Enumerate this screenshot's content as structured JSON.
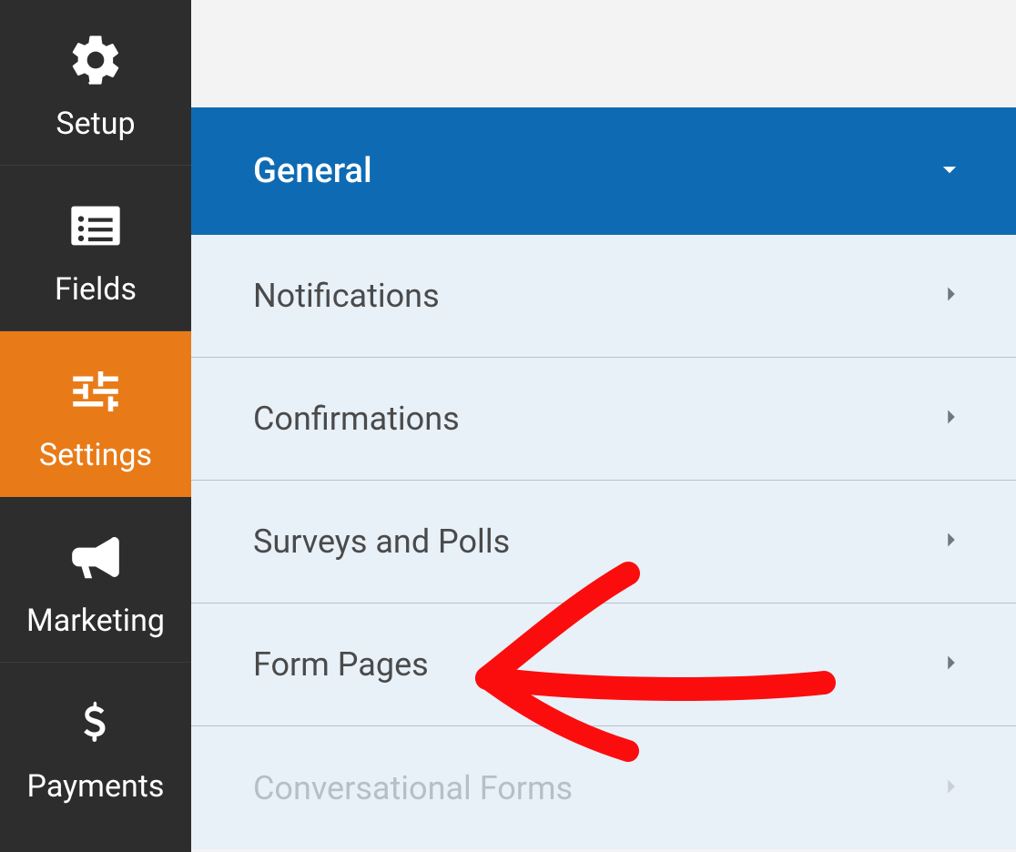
{
  "colors": {
    "sidebar_bg": "#2d2d2d",
    "sidebar_active": "#e87b18",
    "row_bg": "#e8f0f8",
    "row_active_bg": "#0e6bb3",
    "page_bg": "#f3f3f3",
    "text_dark": "#4a4a4a",
    "text_disabled": "#b6bfc7",
    "annotation_red": "#fb0d0e"
  },
  "sidebar": {
    "items": [
      {
        "label": "Setup",
        "icon": "gear-icon",
        "active": false
      },
      {
        "label": "Fields",
        "icon": "list-icon",
        "active": false
      },
      {
        "label": "Settings",
        "icon": "sliders-icon",
        "active": true
      },
      {
        "label": "Marketing",
        "icon": "bullhorn-icon",
        "active": false
      },
      {
        "label": "Payments",
        "icon": "dollar-icon",
        "active": false
      }
    ]
  },
  "settings_panel": {
    "rows": [
      {
        "label": "General",
        "expanded": true,
        "disabled": false
      },
      {
        "label": "Notifications",
        "expanded": false,
        "disabled": false
      },
      {
        "label": "Confirmations",
        "expanded": false,
        "disabled": false
      },
      {
        "label": "Surveys and Polls",
        "expanded": false,
        "disabled": false
      },
      {
        "label": "Form Pages",
        "expanded": false,
        "disabled": false
      },
      {
        "label": "Conversational Forms",
        "expanded": false,
        "disabled": true
      }
    ]
  },
  "annotation": {
    "target_label": "Form Pages",
    "type": "hand-drawn-arrow"
  }
}
